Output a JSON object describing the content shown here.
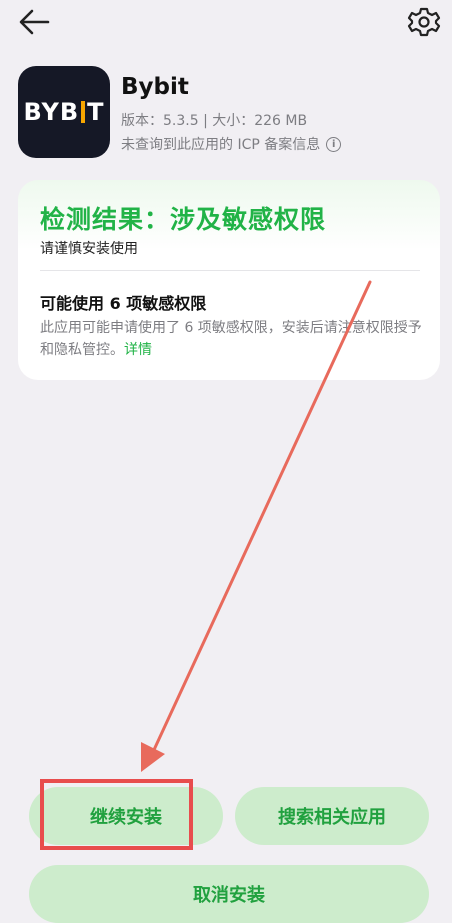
{
  "header": {
    "back_icon": "arrow-left-icon",
    "settings_icon": "gear-icon"
  },
  "app": {
    "logo_text_left": "BYB",
    "logo_text_right": "T",
    "name": "Bybit",
    "meta": "版本：5.3.5 | 大小：226 MB",
    "icp": "未查询到此应用的 ICP 备案信息",
    "info_icon": "i"
  },
  "card": {
    "title": "检测结果：涉及敏感权限",
    "subtitle": "请谨慎安装使用",
    "perm_title": "可能使用 6 项敏感权限",
    "perm_desc": "此应用可能申请使用了 6 项敏感权限，安装后请注意权限授予和隐私管控。",
    "perm_link": "详情"
  },
  "buttons": {
    "continue": "继续安装",
    "search": "搜索相关应用",
    "cancel": "取消安装"
  },
  "colors": {
    "accent": "#21b347",
    "button_bg": "#cdeccc",
    "annotation": "#e84d4d"
  }
}
